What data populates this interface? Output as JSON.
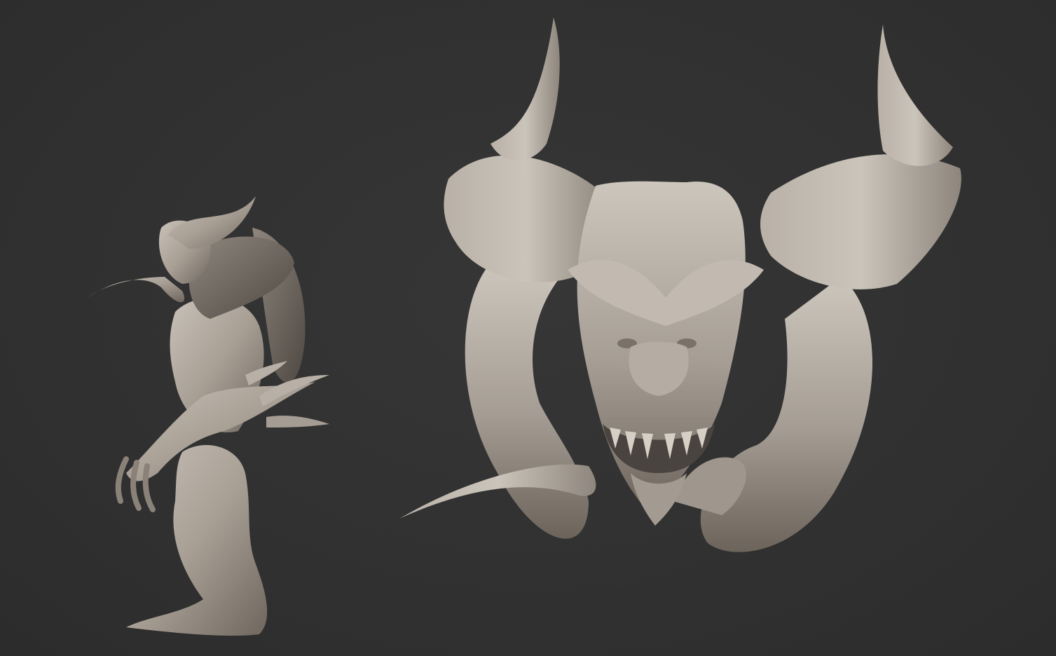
{
  "scene": {
    "background_color": "#313131",
    "clay_color": "#aea69c",
    "clay_shadow": "#6e665d",
    "clay_highlight": "#cfc8bf",
    "models": [
      {
        "name": "full-body-demon",
        "view": "side"
      },
      {
        "name": "horned-demon-head",
        "view": "front"
      }
    ]
  }
}
